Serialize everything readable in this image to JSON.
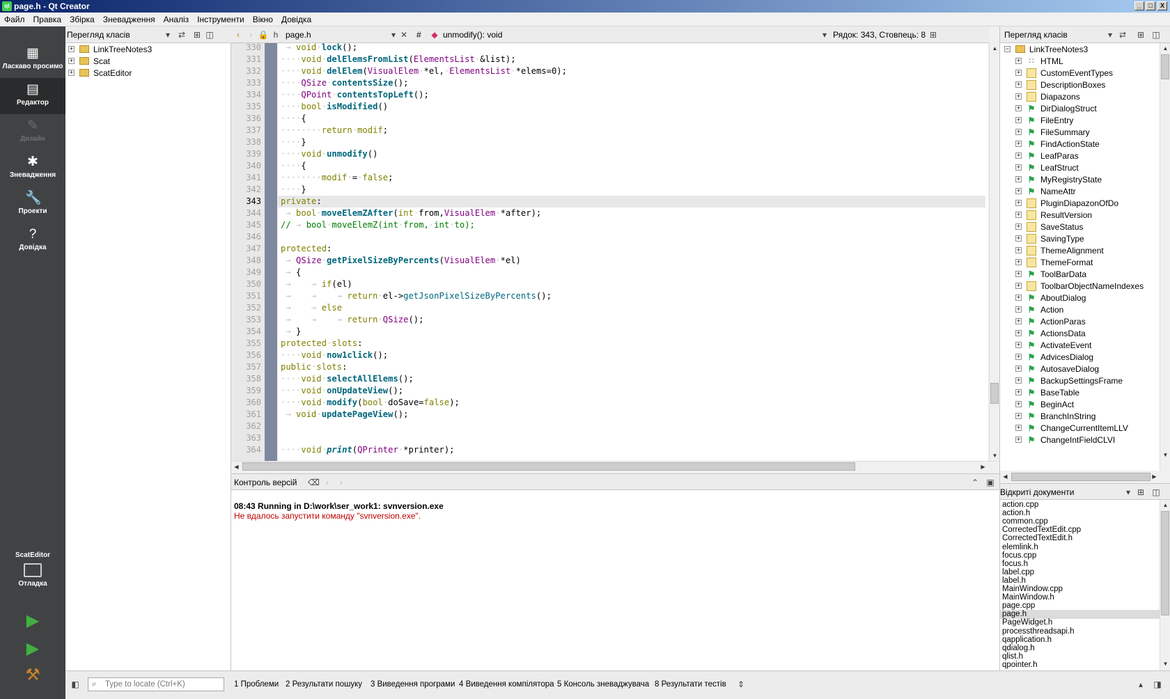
{
  "window": {
    "title": "page.h - Qt Creator",
    "icon": "qt-icon",
    "min": "_",
    "max": "□",
    "close": "X"
  },
  "menu": [
    "Файл",
    "Правка",
    "Збірка",
    "Зневадження",
    "Аналіз",
    "Інструменти",
    "Вікно",
    "Довідка"
  ],
  "modes": [
    {
      "label": "Ласкаво просимо",
      "icon": "welcome-grid-icon",
      "glyph": "▦"
    },
    {
      "label": "Редактор",
      "icon": "editor-icon",
      "glyph": "▤"
    },
    {
      "label": "Дизайн",
      "icon": "design-pencil-icon",
      "glyph": "✎"
    },
    {
      "label": "Зневадження",
      "icon": "debug-bug-icon",
      "glyph": "✱"
    },
    {
      "label": "Проекти",
      "icon": "projects-wrench-icon",
      "glyph": "🔧"
    },
    {
      "label": "Довідка",
      "icon": "help-icon",
      "glyph": "?"
    }
  ],
  "target": {
    "project": "ScatEditor",
    "mode": "Отладка",
    "icon": "monitor-icon"
  },
  "run": {
    "run_icon": "run-icon",
    "debug_icon": "debug-run-icon",
    "build_icon": "build-hammer-icon"
  },
  "left_panel": {
    "title": "Перегляд класів",
    "items": [
      "LinkTreeNotes3",
      "Scat",
      "ScatEditor"
    ]
  },
  "editor": {
    "file": "page.h",
    "hash": "#",
    "symbol": "unmodify(): void",
    "position": "Рядок: 343, Стовпець: 8",
    "lines": [
      "330",
      "331",
      "332",
      "333",
      "334",
      "335",
      "336",
      "337",
      "338",
      "339",
      "340",
      "341",
      "342",
      "343",
      "344",
      "345",
      "346",
      "347",
      "348",
      "349",
      "350",
      "351",
      "352",
      "353",
      "354",
      "355",
      "356",
      "357",
      "358",
      "359",
      "360",
      "361",
      "362",
      "363",
      "364"
    ],
    "current_line": "343"
  },
  "output": {
    "title": "Контроль версій",
    "line1": "08:43 Running in D:\\work\\ser_work1: svnversion.exe",
    "line2": "Не вдалось запустити команду \"svnversion.exe\"."
  },
  "right_panel": {
    "title": "Перегляд класів",
    "root": "LinkTreeNotes3",
    "items": [
      {
        "name": "HTML",
        "kind": "ns"
      },
      {
        "name": "CustomEventTypes",
        "kind": "cls"
      },
      {
        "name": "DescriptionBoxes",
        "kind": "cls"
      },
      {
        "name": "Diapazons",
        "kind": "cls"
      },
      {
        "name": "DirDialogStruct",
        "kind": "struct"
      },
      {
        "name": "FileEntry",
        "kind": "struct"
      },
      {
        "name": "FileSummary",
        "kind": "struct"
      },
      {
        "name": "FindActionState",
        "kind": "struct"
      },
      {
        "name": "LeafParas",
        "kind": "struct"
      },
      {
        "name": "LeafStruct",
        "kind": "struct"
      },
      {
        "name": "MyRegistryState",
        "kind": "struct"
      },
      {
        "name": "NameAttr",
        "kind": "struct"
      },
      {
        "name": "PluginDiapazonOfDo",
        "kind": "cls"
      },
      {
        "name": "ResultVersion",
        "kind": "cls"
      },
      {
        "name": "SaveStatus",
        "kind": "cls"
      },
      {
        "name": "SavingType",
        "kind": "cls"
      },
      {
        "name": "ThemeAlignment",
        "kind": "cls"
      },
      {
        "name": "ThemeFormat",
        "kind": "cls"
      },
      {
        "name": "ToolBarData",
        "kind": "struct"
      },
      {
        "name": "ToolbarObjectNameIndexes",
        "kind": "cls"
      },
      {
        "name": "AboutDialog",
        "kind": "struct"
      },
      {
        "name": "Action",
        "kind": "struct"
      },
      {
        "name": "ActionParas",
        "kind": "struct"
      },
      {
        "name": "ActionsData",
        "kind": "struct"
      },
      {
        "name": "ActivateEvent",
        "kind": "struct"
      },
      {
        "name": "AdvicesDialog",
        "kind": "struct"
      },
      {
        "name": "AutosaveDialog",
        "kind": "struct"
      },
      {
        "name": "BackupSettingsFrame",
        "kind": "struct"
      },
      {
        "name": "BaseTable",
        "kind": "struct"
      },
      {
        "name": "BeginAct",
        "kind": "struct"
      },
      {
        "name": "BranchInString",
        "kind": "struct"
      },
      {
        "name": "ChangeCurrentItemLLV",
        "kind": "struct"
      },
      {
        "name": "ChangeIntFieldCLVI",
        "kind": "struct"
      }
    ]
  },
  "open_docs": {
    "title": "Відкриті документи",
    "items": [
      "action.cpp",
      "action.h",
      "common.cpp",
      "CorrectedTextEdit.cpp",
      "CorrectedTextEdit.h",
      "elemlink.h",
      "focus.cpp",
      "focus.h",
      "label.cpp",
      "label.h",
      "MainWindow.cpp",
      "MainWindow.h",
      "page.cpp",
      "page.h",
      "PageWidget.h",
      "processthreadsapi.h",
      "qapplication.h",
      "qdialog.h",
      "qlist.h",
      "qpointer.h"
    ],
    "selected": "page.h"
  },
  "statusbar": {
    "locator_placeholder": "Type to locate (Ctrl+K)",
    "tabs": [
      "1  Проблеми",
      "2  Результати пошуку",
      "3  Виведення програми",
      "4  Виведення компілятора",
      "5  Консоль зневаджувача",
      "8  Результати тестів"
    ]
  },
  "colors": {
    "keyword": "#808000",
    "type": "#800080",
    "function": "#00677c",
    "comment": "#008000",
    "modebar": "#404244",
    "error": "#c00000"
  }
}
